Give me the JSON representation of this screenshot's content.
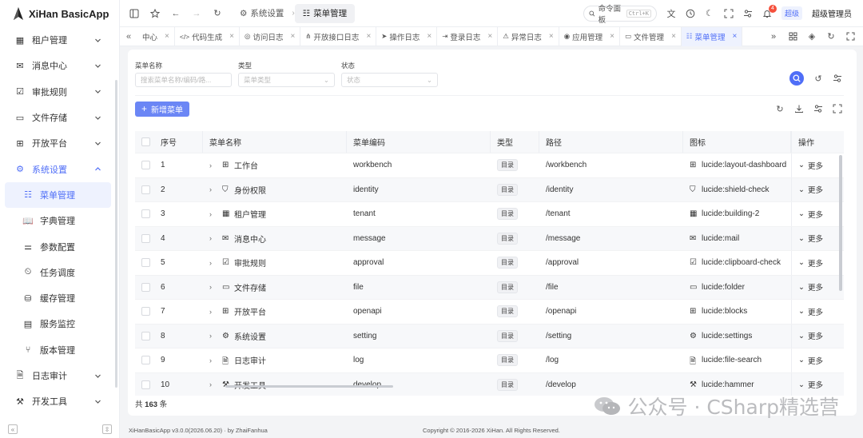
{
  "app": {
    "title": "XiHan BasicApp",
    "brand_color": "#4f6ef7"
  },
  "sidebar": {
    "items": [
      {
        "label": "租户管理",
        "icon": "building-icon",
        "expandable": true
      },
      {
        "label": "消息中心",
        "icon": "mail-icon",
        "expandable": true
      },
      {
        "label": "审批规则",
        "icon": "clipboard-check-icon",
        "expandable": true
      },
      {
        "label": "文件存储",
        "icon": "folder-icon",
        "expandable": true
      },
      {
        "label": "开放平台",
        "icon": "blocks-icon",
        "expandable": true
      },
      {
        "label": "系统设置",
        "icon": "settings-icon",
        "expandable": true,
        "open": true
      },
      {
        "label": "菜单管理",
        "icon": "list-tree-icon",
        "sub": true,
        "active": true
      },
      {
        "label": "字典管理",
        "icon": "book-icon",
        "sub": true
      },
      {
        "label": "参数配置",
        "icon": "sliders-icon",
        "sub": true
      },
      {
        "label": "任务调度",
        "icon": "timer-icon",
        "sub": true
      },
      {
        "label": "缓存管理",
        "icon": "database-icon",
        "sub": true
      },
      {
        "label": "服务监控",
        "icon": "server-icon",
        "sub": true
      },
      {
        "label": "版本管理",
        "icon": "git-branch-icon",
        "sub": true
      },
      {
        "label": "日志审计",
        "icon": "file-search-icon",
        "expandable": true
      },
      {
        "label": "开发工具",
        "icon": "hammer-icon",
        "expandable": true
      }
    ]
  },
  "header": {
    "breadcrumb": [
      {
        "label": "系统设置",
        "icon": "settings-icon"
      },
      {
        "label": "菜单管理",
        "icon": "list-tree-icon"
      }
    ],
    "command_palette": {
      "label": "命令面板",
      "shortcut": "Ctrl+K"
    },
    "notification_count": "4",
    "role": "超级",
    "user": "超级管理员"
  },
  "tabs": [
    {
      "label": "中心"
    },
    {
      "label": "代码生成",
      "icon": "code-icon"
    },
    {
      "label": "访问日志",
      "icon": "globe-icon"
    },
    {
      "label": "开放接口日志",
      "icon": "network-icon"
    },
    {
      "label": "操作日志",
      "icon": "pointer-icon"
    },
    {
      "label": "登录日志",
      "icon": "log-in-icon"
    },
    {
      "label": "异常日志",
      "icon": "alert-icon"
    },
    {
      "label": "应用管理",
      "icon": "app-icon"
    },
    {
      "label": "文件管理",
      "icon": "folder-icon"
    },
    {
      "label": "菜单管理",
      "icon": "list-tree-icon",
      "active": true
    }
  ],
  "filters": {
    "name": {
      "label": "菜单名称",
      "placeholder": "搜索菜单名称/编码/路..."
    },
    "type": {
      "label": "类型",
      "placeholder": "菜单类型"
    },
    "status": {
      "label": "状态",
      "placeholder": "状态"
    }
  },
  "toolbar": {
    "add_label": "新增菜单"
  },
  "table": {
    "columns": [
      "序号",
      "菜单名称",
      "菜单编码",
      "类型",
      "路径",
      "图标",
      "操作"
    ],
    "rows": [
      {
        "no": "1",
        "name": "工作台",
        "code": "workbench",
        "type": "目录",
        "path": "/workbench",
        "icon": "lucide:layout-dashboard",
        "op": "更多"
      },
      {
        "no": "2",
        "name": "身份权限",
        "code": "identity",
        "type": "目录",
        "path": "/identity",
        "icon": "lucide:shield-check",
        "op": "更多"
      },
      {
        "no": "3",
        "name": "租户管理",
        "code": "tenant",
        "type": "目录",
        "path": "/tenant",
        "icon": "lucide:building-2",
        "op": "更多"
      },
      {
        "no": "4",
        "name": "消息中心",
        "code": "message",
        "type": "目录",
        "path": "/message",
        "icon": "lucide:mail",
        "op": "更多"
      },
      {
        "no": "5",
        "name": "审批规则",
        "code": "approval",
        "type": "目录",
        "path": "/approval",
        "icon": "lucide:clipboard-check",
        "op": "更多"
      },
      {
        "no": "6",
        "name": "文件存储",
        "code": "file",
        "type": "目录",
        "path": "/file",
        "icon": "lucide:folder",
        "op": "更多"
      },
      {
        "no": "7",
        "name": "开放平台",
        "code": "openapi",
        "type": "目录",
        "path": "/openapi",
        "icon": "lucide:blocks",
        "op": "更多"
      },
      {
        "no": "8",
        "name": "系统设置",
        "code": "setting",
        "type": "目录",
        "path": "/setting",
        "icon": "lucide:settings",
        "op": "更多"
      },
      {
        "no": "9",
        "name": "日志审计",
        "code": "log",
        "type": "目录",
        "path": "/log",
        "icon": "lucide:file-search",
        "op": "更多"
      },
      {
        "no": "10",
        "name": "开发工具",
        "code": "develop",
        "type": "目录",
        "path": "/develop",
        "icon": "lucide:hammer",
        "op": "更多"
      }
    ],
    "total_prefix": "共",
    "total_count": "163",
    "total_suffix": "条"
  },
  "footer": {
    "version": "XiHanBasicApp v3.0.0(2026.06.20) · by ZhaiFanhua",
    "copyright": "Copyright © 2016-2026 XiHan. All Rights Reserved."
  },
  "watermark": {
    "text": "公众号 · CSharp精选营"
  }
}
